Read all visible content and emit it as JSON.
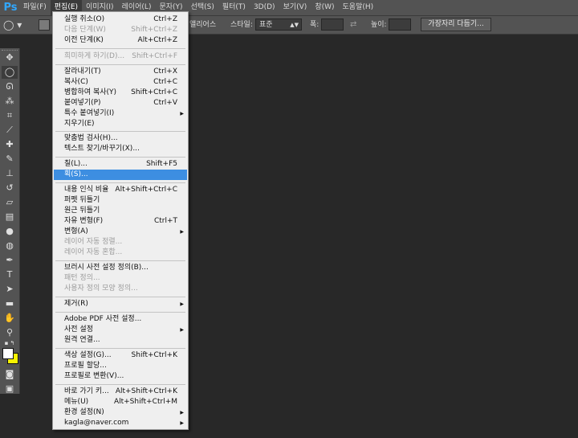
{
  "app": {
    "logo": "Ps"
  },
  "menubar": {
    "items": [
      "파일(F)",
      "편집(E)",
      "이미지(I)",
      "레이어(L)",
      "문자(Y)",
      "선택(S)",
      "필터(T)",
      "3D(D)",
      "보기(V)",
      "창(W)",
      "도움말(H)"
    ]
  },
  "options": {
    "antialias_label": "앨리어스",
    "style_label": "스타일:",
    "style_value": "표준",
    "width_label": "폭:",
    "height_label": "높이:",
    "refine_edge_button": "가장자리 다듬기..."
  },
  "colors": {
    "foreground": "#ffffff",
    "background": "#f7f300",
    "highlight": "#3d8ee1"
  },
  "edit_menu": {
    "items": [
      {
        "label": "실행 취소(O)",
        "shortcut": "Ctrl+Z"
      },
      {
        "label": "다음 단계(W)",
        "shortcut": "Shift+Ctrl+Z"
      },
      {
        "label": "이전 단계(K)",
        "shortcut": "Alt+Ctrl+Z"
      },
      {
        "label": "희미하게 하기(D)...",
        "shortcut": "Shift+Ctrl+F"
      },
      {
        "label": "잘라내기(T)",
        "shortcut": "Ctrl+X"
      },
      {
        "label": "복사(C)",
        "shortcut": "Ctrl+C"
      },
      {
        "label": "병합하여 복사(Y)",
        "shortcut": "Shift+Ctrl+C"
      },
      {
        "label": "붙여넣기(P)",
        "shortcut": "Ctrl+V"
      },
      {
        "label": "특수 붙여넣기(I)",
        "shortcut": ""
      },
      {
        "label": "지우기(E)",
        "shortcut": ""
      },
      {
        "label": "맞춤법 검사(H)...",
        "shortcut": ""
      },
      {
        "label": "텍스트 찾기/바꾸기(X)...",
        "shortcut": ""
      },
      {
        "label": "칠(L)...",
        "shortcut": "Shift+F5"
      },
      {
        "label": "획(S)...",
        "shortcut": ""
      },
      {
        "label": "내용 인식 비율",
        "shortcut": "Alt+Shift+Ctrl+C"
      },
      {
        "label": "퍼펫 뒤틀기",
        "shortcut": ""
      },
      {
        "label": "원근 뒤틀기",
        "shortcut": ""
      },
      {
        "label": "자유 변형(F)",
        "shortcut": "Ctrl+T"
      },
      {
        "label": "변형(A)",
        "shortcut": ""
      },
      {
        "label": "레이어 자동 정렬...",
        "shortcut": ""
      },
      {
        "label": "레이어 자동 혼합...",
        "shortcut": ""
      },
      {
        "label": "브러시 사전 설정 정의(B)...",
        "shortcut": ""
      },
      {
        "label": "패턴 정의...",
        "shortcut": ""
      },
      {
        "label": "사용자 정의 모양 정의...",
        "shortcut": ""
      },
      {
        "label": "제거(R)",
        "shortcut": ""
      },
      {
        "label": "Adobe PDF 사전 설정...",
        "shortcut": ""
      },
      {
        "label": "사전 설정",
        "shortcut": ""
      },
      {
        "label": "원격 연결...",
        "shortcut": ""
      },
      {
        "label": "색상 설정(G)...",
        "shortcut": "Shift+Ctrl+K"
      },
      {
        "label": "프로필 할당...",
        "shortcut": ""
      },
      {
        "label": "프로필로 변환(V)...",
        "shortcut": ""
      },
      {
        "label": "바로 가기 키...",
        "shortcut": "Alt+Shift+Ctrl+K"
      },
      {
        "label": "메뉴(U)",
        "shortcut": "Alt+Shift+Ctrl+M"
      },
      {
        "label": "환경 설정(N)",
        "shortcut": ""
      },
      {
        "label": "kagla@naver.com",
        "shortcut": ""
      }
    ]
  }
}
